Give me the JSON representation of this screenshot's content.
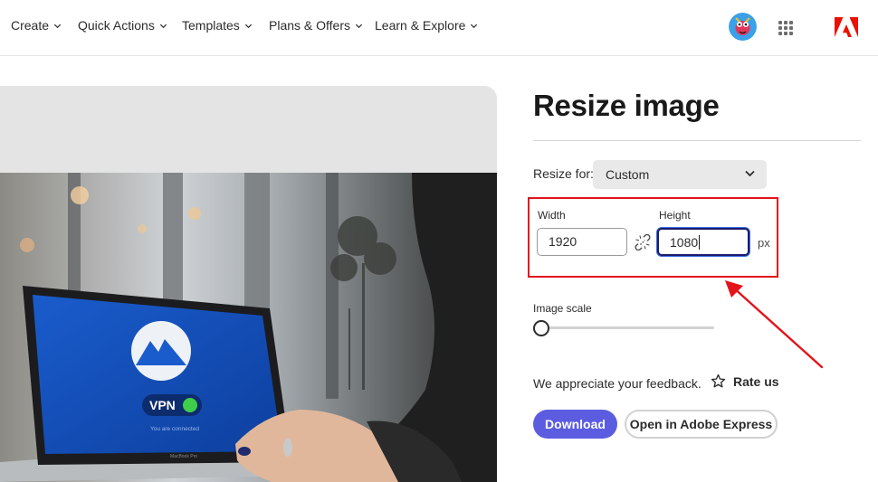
{
  "nav": {
    "items": [
      {
        "label": "Create"
      },
      {
        "label": "Quick Actions"
      },
      {
        "label": "Templates"
      },
      {
        "label": "Plans & Offers"
      },
      {
        "label": "Learn & Explore"
      }
    ],
    "avatar_icon": "user-avatar",
    "apps_icon": "app-grid-icon",
    "logo_icon": "adobe-logo"
  },
  "preview": {
    "laptop_badge": "VPN",
    "laptop_status": "You are connected",
    "laptop_brand": "MacBook Pro"
  },
  "panel": {
    "title": "Resize image",
    "resize_for_label": "Resize for:",
    "resize_for_value": "Custom",
    "width_label": "Width",
    "width_value": "1920",
    "height_label": "Height",
    "height_value": "1080",
    "unit": "px",
    "link_icon": "unlink-icon",
    "image_scale_label": "Image scale",
    "image_scale_value": 0,
    "feedback_text": "We appreciate your feedback.",
    "rate_label": "Rate us",
    "download_label": "Download",
    "open_label": "Open in Adobe Express"
  },
  "colors": {
    "accent": "#5c5ce0",
    "annotation": "#e3141a",
    "adobe_red": "#eb1000"
  }
}
